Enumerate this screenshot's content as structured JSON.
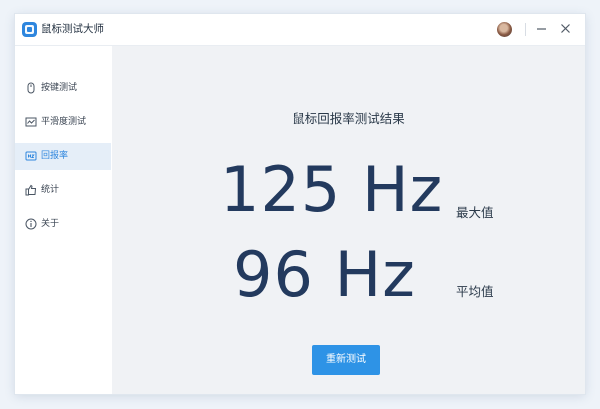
{
  "app": {
    "title": "鼠标测试大师",
    "icon": "mouse-app-logo"
  },
  "titlebar": {
    "avatar_icon": "user-avatar",
    "minimize_icon": "minimize-icon",
    "close_icon": "close-icon"
  },
  "sidebar": {
    "items": [
      {
        "label": "按键测试",
        "icon": "mouse-icon",
        "active": false
      },
      {
        "label": "平滑度测试",
        "icon": "wave-chart-icon",
        "active": false
      },
      {
        "label": "回报率",
        "icon": "hz-icon",
        "active": true
      },
      {
        "label": "统计",
        "icon": "thumbs-up-icon",
        "active": false
      },
      {
        "label": "关于",
        "icon": "info-icon",
        "active": false
      }
    ]
  },
  "main": {
    "title": "鼠标回报率测试结果",
    "max_value": "125 Hz",
    "max_label": "最大值",
    "avg_value": "96 Hz",
    "avg_label": "平均值",
    "retest_label": "重新测试"
  },
  "colors": {
    "accent": "#2e86de",
    "button": "#2e93e6",
    "value_text": "#233a5e",
    "active_item_bg": "#e5eef8",
    "main_bg": "#f0f2f5"
  }
}
